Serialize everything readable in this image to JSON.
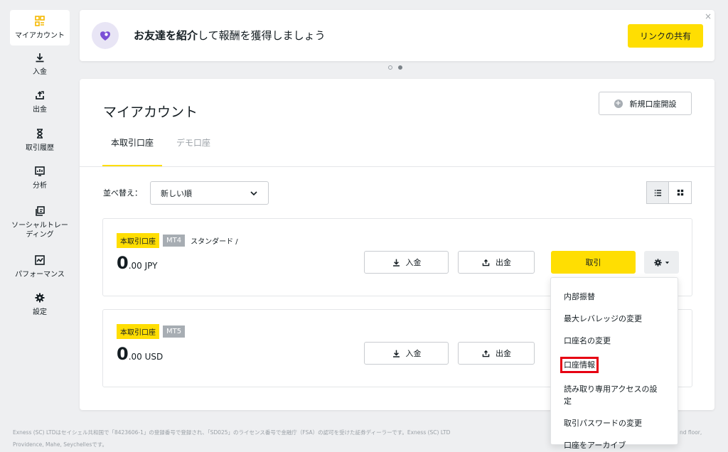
{
  "sidebar": {
    "items": [
      {
        "label": "マイアカウント",
        "icon": "grid-icon",
        "active": true
      },
      {
        "label": "入金",
        "icon": "download-icon"
      },
      {
        "label": "出金",
        "icon": "upload-icon"
      },
      {
        "label": "取引履歴",
        "icon": "hourglass-icon"
      },
      {
        "label": "分析",
        "icon": "chart-icon"
      },
      {
        "label": "ソーシャルトレーディング",
        "icon": "copy-icon"
      },
      {
        "label": "パフォーマンス",
        "icon": "performance-icon"
      },
      {
        "label": "設定",
        "icon": "gear-icon"
      }
    ]
  },
  "banner": {
    "text_bold": "お友達を紹介",
    "text_rest": "して報酬を獲得しましょう",
    "share_label": "リンクの共有",
    "close": "×"
  },
  "main": {
    "title": "マイアカウント",
    "new_account_label": "新規口座開設",
    "tabs": [
      {
        "label": "本取引口座",
        "active": true
      },
      {
        "label": "デモ口座"
      }
    ],
    "sort_label": "並べ替え：",
    "sort_value": "新しい順"
  },
  "accounts": [
    {
      "type": "本取引口座",
      "platform": "MT4",
      "name": "スタンダード /",
      "balance_int": "0",
      "balance_dec": ".00 JPY",
      "deposit": "入金",
      "withdraw": "出金",
      "trade": "取引"
    },
    {
      "type": "本取引口座",
      "platform": "MT5",
      "balance_int": "0",
      "balance_dec": ".00 USD",
      "deposit": "入金",
      "withdraw": "出金"
    }
  ],
  "menu": {
    "items": [
      "内部振替",
      "最大レバレッジの変更",
      "口座名の変更",
      "口座情報",
      "読み取り専用アクセスの設定",
      "取引パスワードの変更",
      "口座をアーカイブ"
    ]
  },
  "footer": {
    "line1": "Exness (SC) LTDはセイシェル共和国で「8423606-1」の登録番号で登録され、「SD025」のライセンス番号で金融庁（FSA）の認可を受けた証券ディーラーです。Exness (SC) LTD",
    "line1_right": "nd floor,",
    "line2": "Providence, Mahe, Seychellesです。"
  },
  "colors": {
    "accent": "#ffde02",
    "highlight": "#e60012",
    "badge_gray": "#a7adb3"
  }
}
